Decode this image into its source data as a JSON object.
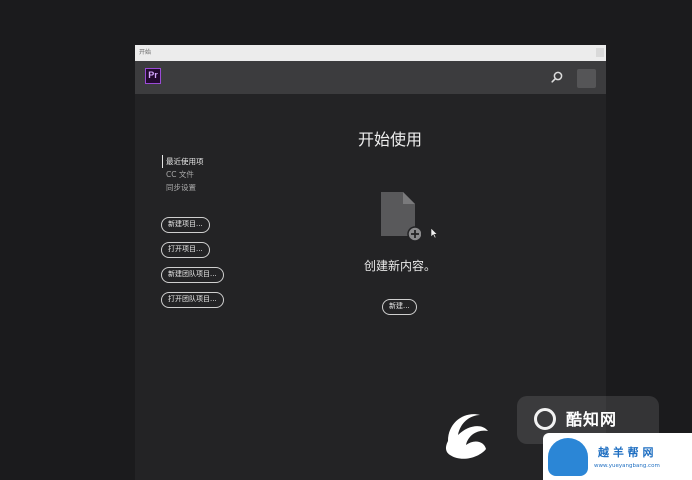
{
  "window": {
    "title": "开始"
  },
  "appbar": {
    "logo_text": "Pr",
    "search_icon": "search-icon",
    "avatar_icon": "user-avatar"
  },
  "sidebar": {
    "nav": [
      {
        "label": "最近使用项",
        "active": true
      },
      {
        "label": "CC 文件",
        "active": false
      },
      {
        "label": "同步设置",
        "active": false
      }
    ],
    "buttons": [
      {
        "label": "新建项目..."
      },
      {
        "label": "打开项目..."
      },
      {
        "label": "新建团队项目..."
      },
      {
        "label": "打开团队项目..."
      }
    ]
  },
  "main": {
    "title": "开始使用",
    "icon": "new-document-icon",
    "prompt": "创建新内容。",
    "new_button": "新建..."
  },
  "watermark": {
    "badge_text": "酷知网",
    "site_name": "越  羊  帮  网",
    "site_url": "www.yueyangbang.com"
  },
  "colors": {
    "background": "#1b1b1d",
    "window": "#232325",
    "appbar": "#3c3c3e",
    "accent_pr": "#9a4bd6"
  }
}
